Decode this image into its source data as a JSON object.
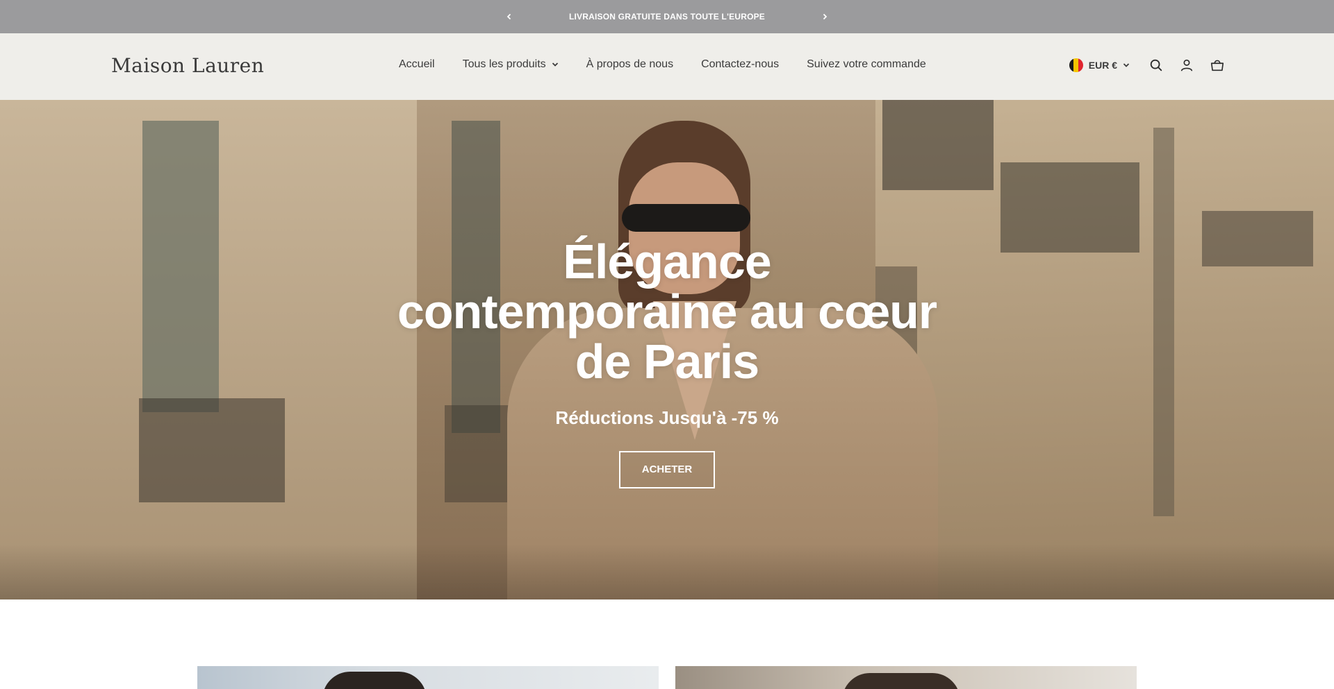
{
  "announcement": {
    "message": "LIVRAISON GRATUITE DANS TOUTE L'EUROPE",
    "prev_icon": "chevron-left-icon",
    "next_icon": "chevron-right-icon"
  },
  "header": {
    "logo": "Maison Lauren",
    "nav": [
      {
        "label": "Accueil"
      },
      {
        "label": "Tous les produits",
        "has_dropdown": true
      },
      {
        "label": "À propos de nous"
      },
      {
        "label": "Contactez-nous"
      },
      {
        "label": "Suivez votre commande"
      }
    ],
    "currency": {
      "label": "EUR €",
      "flag": "belgium-flag-icon"
    },
    "icons": [
      "search-icon",
      "account-icon",
      "cart-icon"
    ]
  },
  "hero": {
    "title": "Élégance contemporaine au cœur de Paris",
    "subtitle": "Réductions Jusqu'à -75 %",
    "button": "ACHETER"
  },
  "colors": {
    "announcement_bg": "#9b9b9d",
    "header_bg": "#efeeea",
    "hero_text": "#ffffff"
  }
}
